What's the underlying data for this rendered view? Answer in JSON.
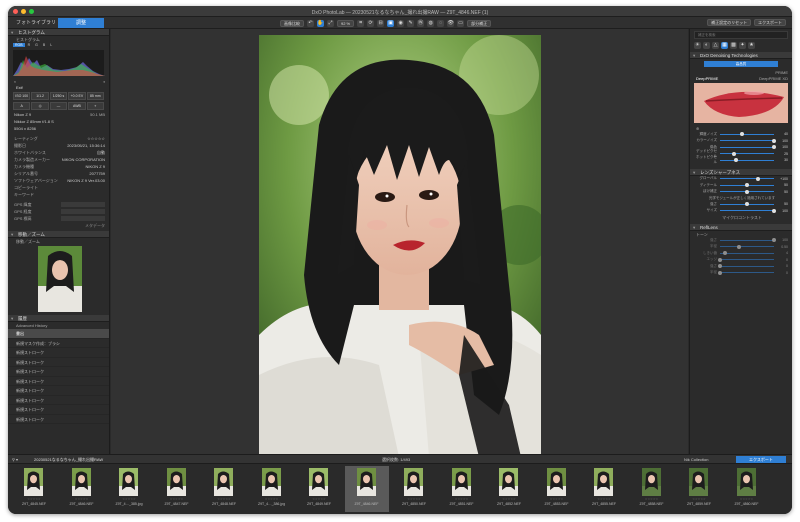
{
  "window": {
    "title": "DxO PhotoLab — 20230521なるなちゃん_撮れ出撮RAW — Z9T_4846.NEF (1)"
  },
  "tabs": [
    {
      "label": "フォトライブラリ"
    },
    {
      "label": "調整"
    }
  ],
  "toolbar": {
    "compare": "画像比較",
    "zoom": "92 %",
    "correct": "部分補正",
    "reset": "補正設定のリセット",
    "export": "エクスポート"
  },
  "left": {
    "histogram_title": "ヒストグラム",
    "histogram_sub": "ヒストグラム",
    "channels": [
      "RGB",
      "R",
      "G",
      "B",
      "L"
    ],
    "exif_title": "Exif",
    "exif_chips": [
      "ISO 100",
      "1/1.2",
      "1/250 s",
      "+0.0 EV",
      "85 mm"
    ],
    "camera": "Nikon Z 9",
    "size": "50.1 MB",
    "lens": "Nikkor Z 85mm f/1.8 S",
    "dims": "5504 x 8256",
    "meta": [
      {
        "label": "レーティング",
        "value": "☆☆☆☆☆"
      },
      {
        "label": "撮影日",
        "value": "2023/05/21, 15:36:14"
      },
      {
        "label": "ホワイトバランス",
        "value": "自動"
      },
      {
        "label": "カメラ製造メーカー",
        "value": "NIKON CORPORATION"
      },
      {
        "label": "カメラ機種",
        "value": "NIKON Z 9"
      },
      {
        "label": "シリアル番号",
        "value": "2077759"
      },
      {
        "label": "ソフトウェアバージョン",
        "value": "NIKON Z 9 Ver.03.00"
      },
      {
        "label": "コピーライト",
        "value": ""
      },
      {
        "label": "キーワード",
        "value": ""
      }
    ],
    "gps": [
      "GPS 緯度",
      "GPS 経度",
      "GPS 標高"
    ],
    "metadata_link": "メタデータ",
    "navigator_title": "移動／ズーム",
    "navigator_sub": "移動／ズーム",
    "history_title": "履歴",
    "history_sub": "Advanced History",
    "history_items": [
      "書出",
      "新規マスク作成：ブラシ",
      "新規ストローク",
      "新規ストローク",
      "新規ストローク",
      "新規ストローク",
      "新規ストローク",
      "新規ストローク",
      "新規ストローク",
      "新規ストローク"
    ]
  },
  "right": {
    "search_placeholder": "補正を検索",
    "denoise_title": "DxO Denoising Technologies",
    "denoise_mode": "高品質",
    "prime": "PRIME",
    "deep_prime": "DeepPRIME",
    "deep_prime_xd": "DeepPRIME XD",
    "denoise_sliders": [
      {
        "label": "輝度ノイズ",
        "value": "40",
        "pct": 0.4
      },
      {
        "label": "カラーノイズ",
        "value": "100",
        "pct": 1.0
      },
      {
        "label": "偽色",
        "value": "100",
        "pct": 1.0
      },
      {
        "label": "デッドピクセル",
        "value": "25",
        "pct": 0.25
      },
      {
        "label": "ホットピクセル",
        "value": "30",
        "pct": 0.3
      }
    ],
    "lens_title": "レンズシャープネス",
    "lens_sliders": [
      {
        "label": "グローバル",
        "value": "+100",
        "pct": 0.7
      },
      {
        "label": "ディテール",
        "value": "50",
        "pct": 0.5
      },
      {
        "label": "ぼけ補正",
        "value": "50",
        "pct": 0.5
      }
    ],
    "auto_note": "光学モジュールが正しく適用されています",
    "reflect_title": "ReflLens",
    "reflect_sliders": [
      {
        "label": "強さ",
        "value": "50",
        "pct": 0.5
      },
      {
        "label": "サイズ",
        "value": "100",
        "pct": 1.0
      }
    ],
    "microcontrast": "マイクロコントラスト",
    "tone_title": "トーン",
    "tone_sliders": [
      {
        "label": "強さ",
        "value": "100",
        "pct": 1.0
      },
      {
        "label": "半径",
        "value": "0.50",
        "pct": 0.35
      },
      {
        "label": "しきい値",
        "value": "4",
        "pct": 0.1
      },
      {
        "label": "エッジ",
        "value": "0",
        "pct": 0.0
      },
      {
        "label": "強さ",
        "value": "0",
        "pct": 0.0
      },
      {
        "label": "半径",
        "value": "0",
        "pct": 0.0
      }
    ]
  },
  "filmstrip": {
    "folder": "20230521なるなちゃん_撮れ出撮RAW",
    "count": "選択枚数: 1/493",
    "nik": "Nik Collection",
    "export": "エクスポート",
    "thumbs": [
      "Z9T_4845.NEF",
      "Z9T_4846.NEF",
      "Z9T_4…_385.jpg",
      "Z9T_4847.NEF",
      "Z9T_4848.NEF",
      "Z9T_4…_386.jpg",
      "Z9T_4849.NEF",
      "Z9T_4846.NEF",
      "Z9T_4850.NEF",
      "Z9T_4851.NEF",
      "Z9T_4852.NEF",
      "Z9T_4853.NEF",
      "Z9T_4855.NEF",
      "Z9T_4858.NEF",
      "Z9T_4859.NEF",
      "Z9T_4860.NEF"
    ],
    "selected_index": 7
  },
  "colors": {
    "accent": "#2f7fd4",
    "panel": "#2b2b2b",
    "viewer": "#323232"
  }
}
